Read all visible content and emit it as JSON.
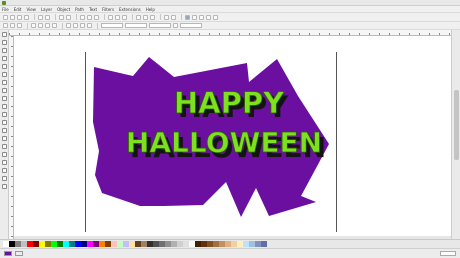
{
  "window": {
    "title": ""
  },
  "menu": {
    "items": [
      "File",
      "Edit",
      "View",
      "Layer",
      "Object",
      "Path",
      "Text",
      "Filters",
      "Extensions",
      "Help"
    ]
  },
  "artwork": {
    "line1": "HAPPY",
    "line2": "HALLOWEEN",
    "shape_color": "#6a0fa0",
    "text_color": "#7fe020",
    "shadow_color": "#141414"
  },
  "palette": {
    "colors": [
      "#ffffff",
      "#000000",
      "#808080",
      "#c0c0c0",
      "#ff0000",
      "#800000",
      "#ffff00",
      "#808000",
      "#00ff00",
      "#008000",
      "#00ffff",
      "#008080",
      "#0000ff",
      "#000080",
      "#ff00ff",
      "#800080",
      "#ff8000",
      "#804000",
      "#ffc0c0",
      "#c0ffc0",
      "#c0c0ff",
      "#ffe0a0",
      "#604020",
      "#a08060",
      "#303030",
      "#505050",
      "#707070",
      "#909090",
      "#b0b0b0",
      "#d0d0d0",
      "#e0e0e0",
      "#f8f8f8",
      "#402000",
      "#603010",
      "#805020",
      "#a07040",
      "#c09060",
      "#e0b080",
      "#f0d0a0",
      "#fff0c0",
      "#c0e0ff",
      "#a0c0e0",
      "#8090c0",
      "#6070a0"
    ]
  },
  "status": {
    "fill_label": "",
    "message": "",
    "zoom": ""
  }
}
